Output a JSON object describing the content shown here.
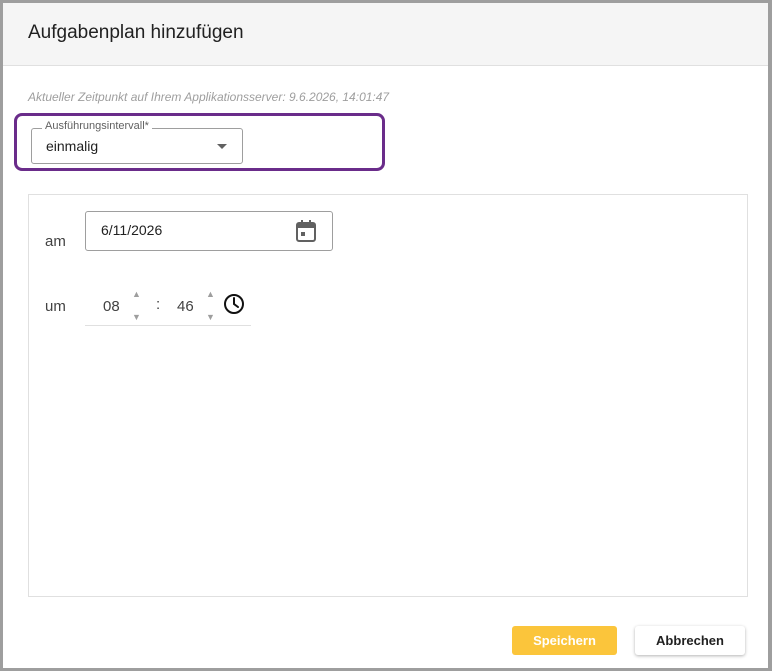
{
  "dialog": {
    "title": "Aufgabenplan hinzufügen",
    "server_time": "Aktueller Zeitpunkt auf Ihrem Applikationsserver: 9.6.2026, 14:01:47"
  },
  "interval": {
    "label": "Ausführungsintervall*",
    "value": "einmalig"
  },
  "schedule": {
    "date_label": "am",
    "date_value": "6/11/2026",
    "time_label": "um",
    "hours": "08",
    "separator": ":",
    "minutes": "46"
  },
  "buttons": {
    "save": "Speichern",
    "cancel": "Abbrechen"
  },
  "colors": {
    "highlight": "#6a2c8a",
    "save_button": "#fbc53b"
  },
  "icons": {
    "calendar": "calendar-icon",
    "clock": "clock-icon",
    "dropdown": "chevron-down-icon"
  }
}
